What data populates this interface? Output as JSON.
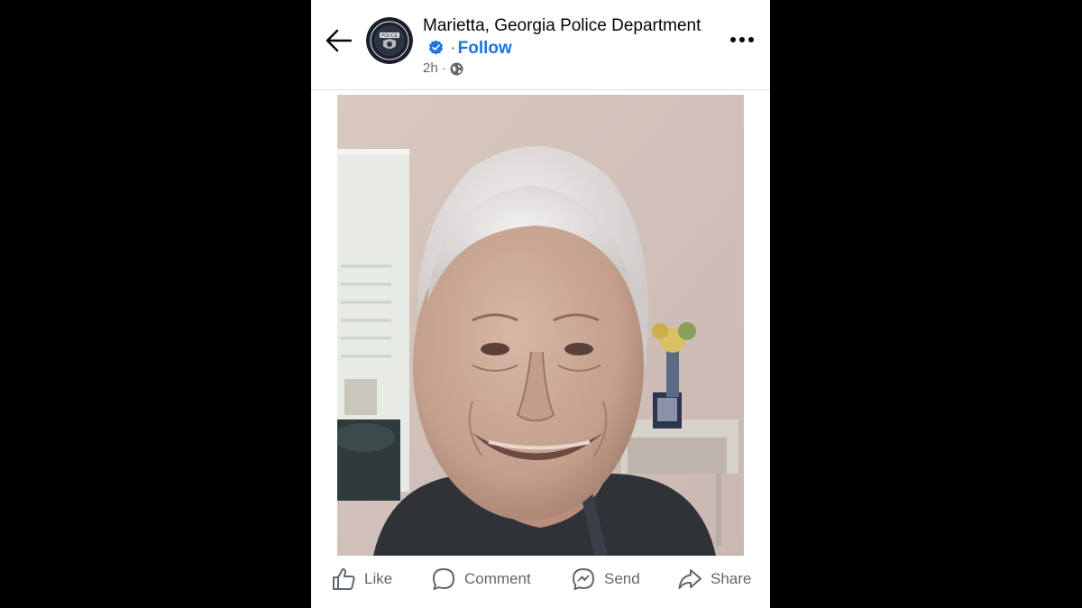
{
  "post": {
    "page_name": "Marietta, Georgia Police Department",
    "separator": "·",
    "follow_label": "Follow",
    "time": "2h",
    "meta_dot": "·",
    "avatar_badge_text": "POLICE"
  },
  "icons": {
    "back": "arrow-left-icon",
    "verified": "verified-badge-icon",
    "audience": "globe-icon",
    "more": "more-dots-icon",
    "like": "thumbs-up-icon",
    "comment": "comment-bubble-icon",
    "send": "messenger-icon",
    "share": "share-arrow-icon"
  },
  "actions": {
    "like": "Like",
    "comment": "Comment",
    "send": "Send",
    "share": "Share"
  },
  "colors": {
    "accent": "#1b74e4",
    "text": "#050505",
    "muted": "#65676b",
    "background": "#000000"
  }
}
